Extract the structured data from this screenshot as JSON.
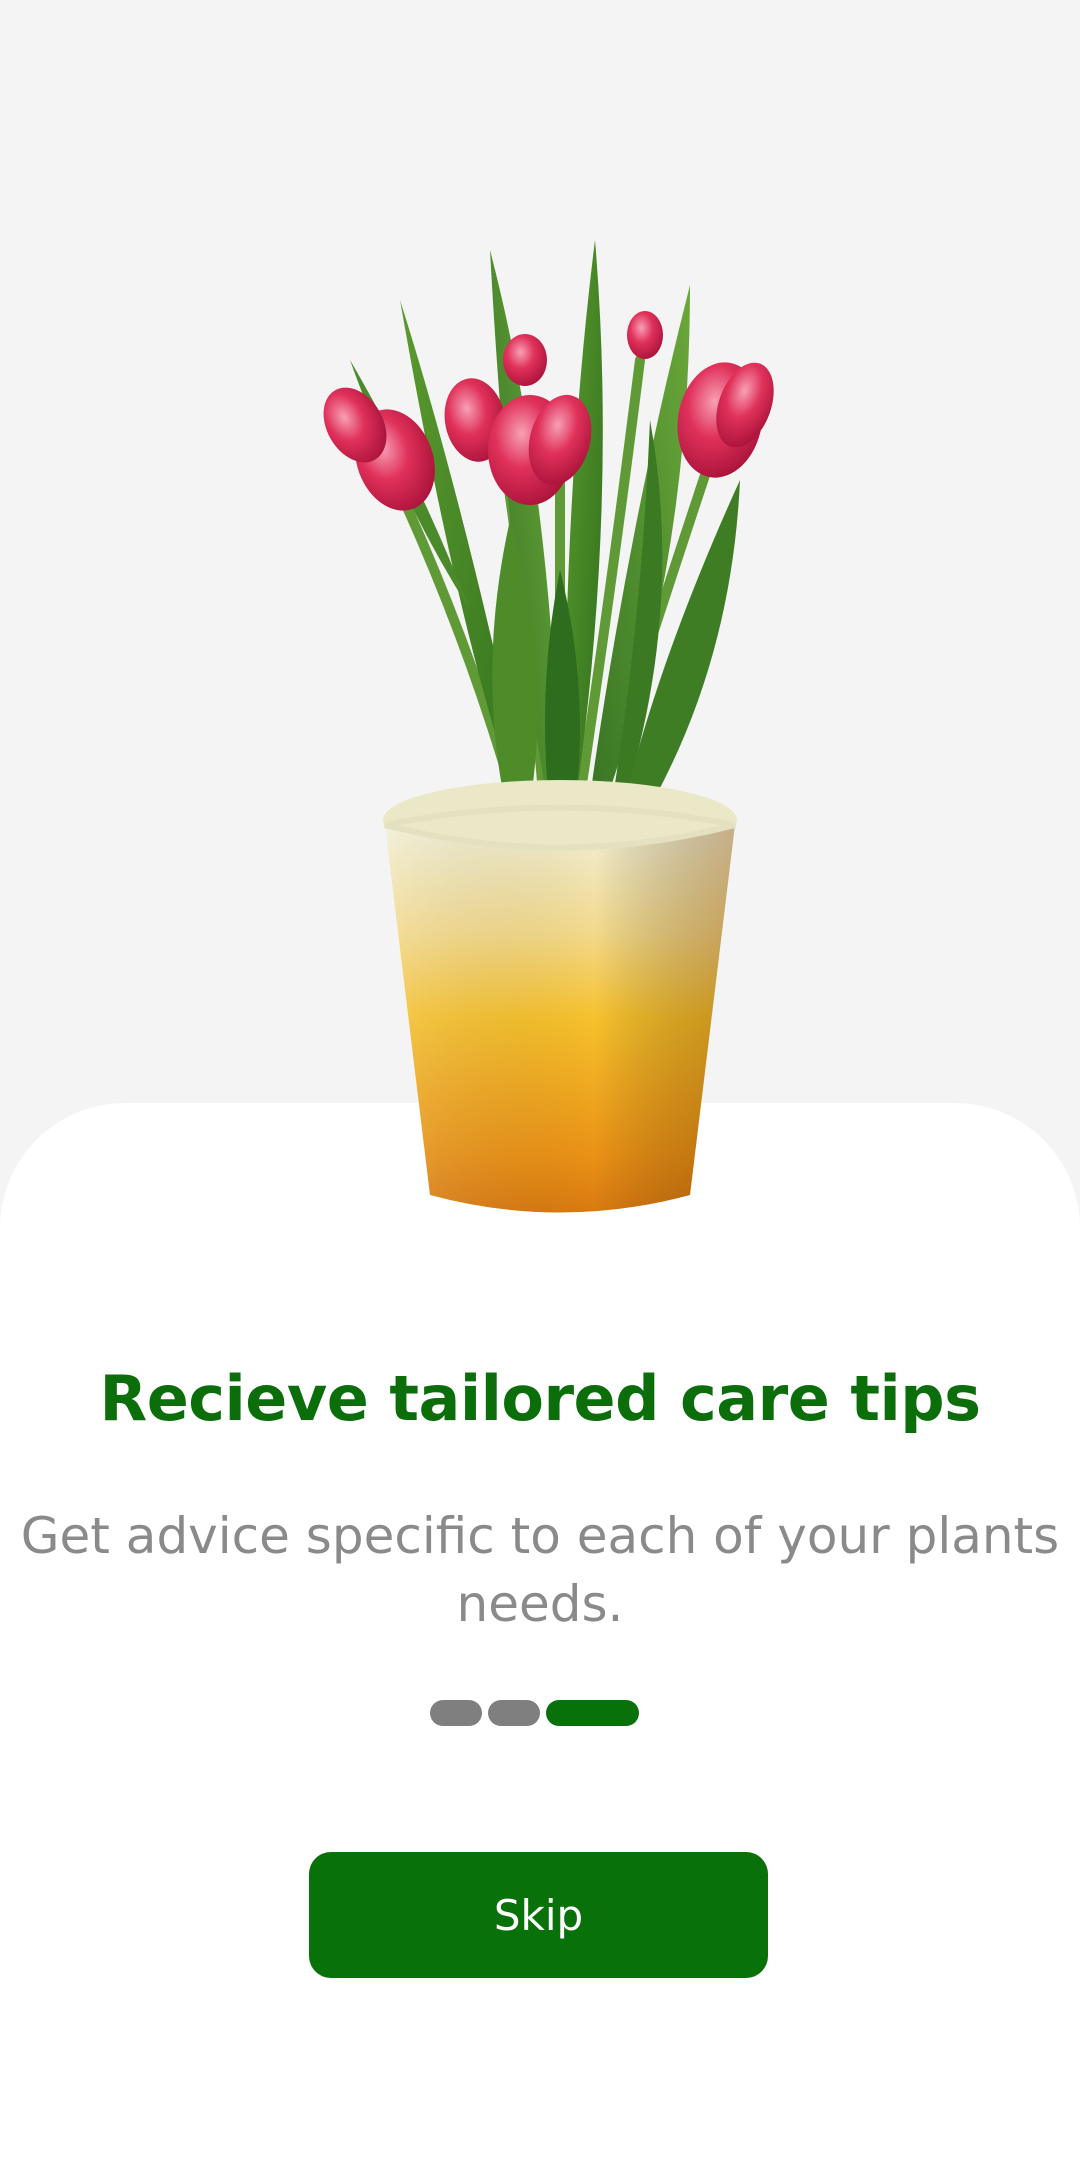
{
  "onboarding": {
    "title": "Recieve tailored care tips",
    "subtitle": "Get advice specific to each of your plants needs.",
    "page_indicator": {
      "total": 3,
      "current": 3
    },
    "skip_label": "Skip"
  },
  "colors": {
    "accent": "#097109",
    "title": "#0b6e0b",
    "subtitle": "#8a8a8a",
    "indicator_inactive": "#7f7f7f",
    "background_top": "#f4f4f4",
    "sheet": "#ffffff"
  },
  "images": {
    "hero": "potted-red-tulips-in-yellow-pot"
  }
}
